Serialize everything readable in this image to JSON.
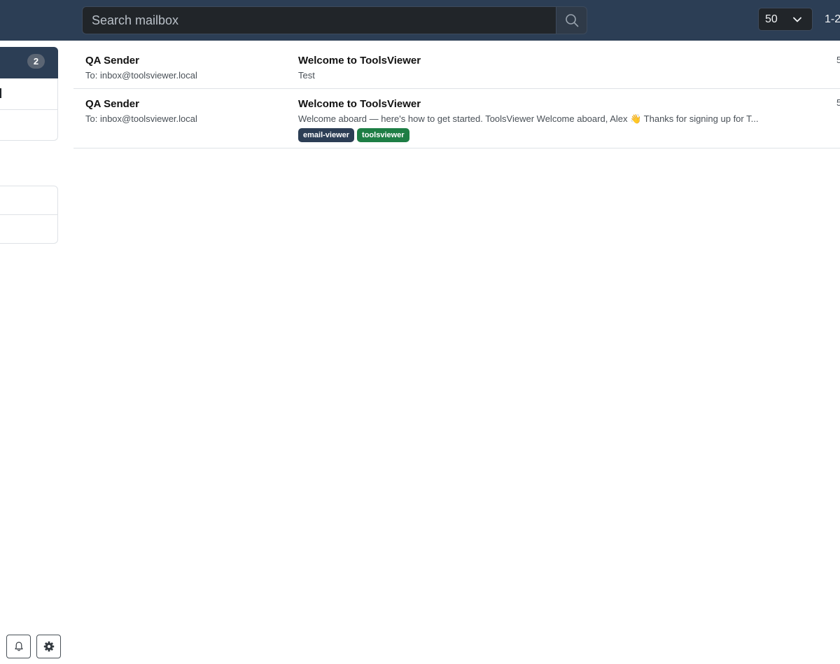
{
  "search": {
    "placeholder": "Search mailbox"
  },
  "pagination": {
    "page_size": "50",
    "range": "1-2"
  },
  "sidebar": {
    "inbox_count": "2"
  },
  "messages": [
    {
      "sender": "QA Sender",
      "to": "To: inbox@toolsviewer.local",
      "subject": "Welcome to ToolsViewer",
      "preview": "Test",
      "time": "5"
    },
    {
      "sender": "QA Sender",
      "to": "To: inbox@toolsviewer.local",
      "subject": "Welcome to ToolsViewer",
      "preview": "Welcome aboard — here's how to get started. ToolsViewer Welcome aboard, Alex 👋 Thanks for signing up for T...",
      "time": "5",
      "tags": [
        {
          "label": "email-viewer",
          "color": "#2c3e55"
        },
        {
          "label": "toolsviewer",
          "color": "#1e7e45"
        }
      ]
    }
  ],
  "icons": {
    "search": "search-icon",
    "dropdown": "chevron-down-icon",
    "notifications": "bell-icon",
    "settings": "gear-icon"
  }
}
